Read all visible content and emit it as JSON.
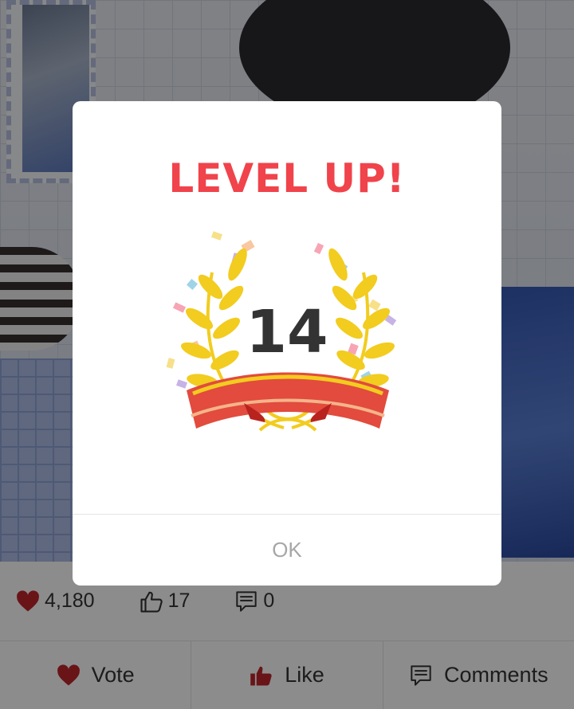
{
  "dialog": {
    "title": "LEVEL UP!",
    "level": "14",
    "ok_label": "OK"
  },
  "stats": {
    "votes": "4,180",
    "likes": "17",
    "comments": "0"
  },
  "actions": {
    "vote_label": "Vote",
    "like_label": "Like",
    "comments_label": "Comments"
  },
  "colors": {
    "title_red": "#f0434b",
    "heart_red": "#c0252b",
    "laurel_gold": "#f2cc1f",
    "ribbon_red": "#e85040"
  },
  "icons": {
    "stat_vote": "heart-icon",
    "stat_like": "thumbs-up-icon",
    "stat_comments": "comment-icon",
    "action_vote": "heart-icon",
    "action_like": "thumbs-up-icon",
    "action_comments": "comment-icon",
    "dialog_badge": "laurel-wreath-icon"
  }
}
